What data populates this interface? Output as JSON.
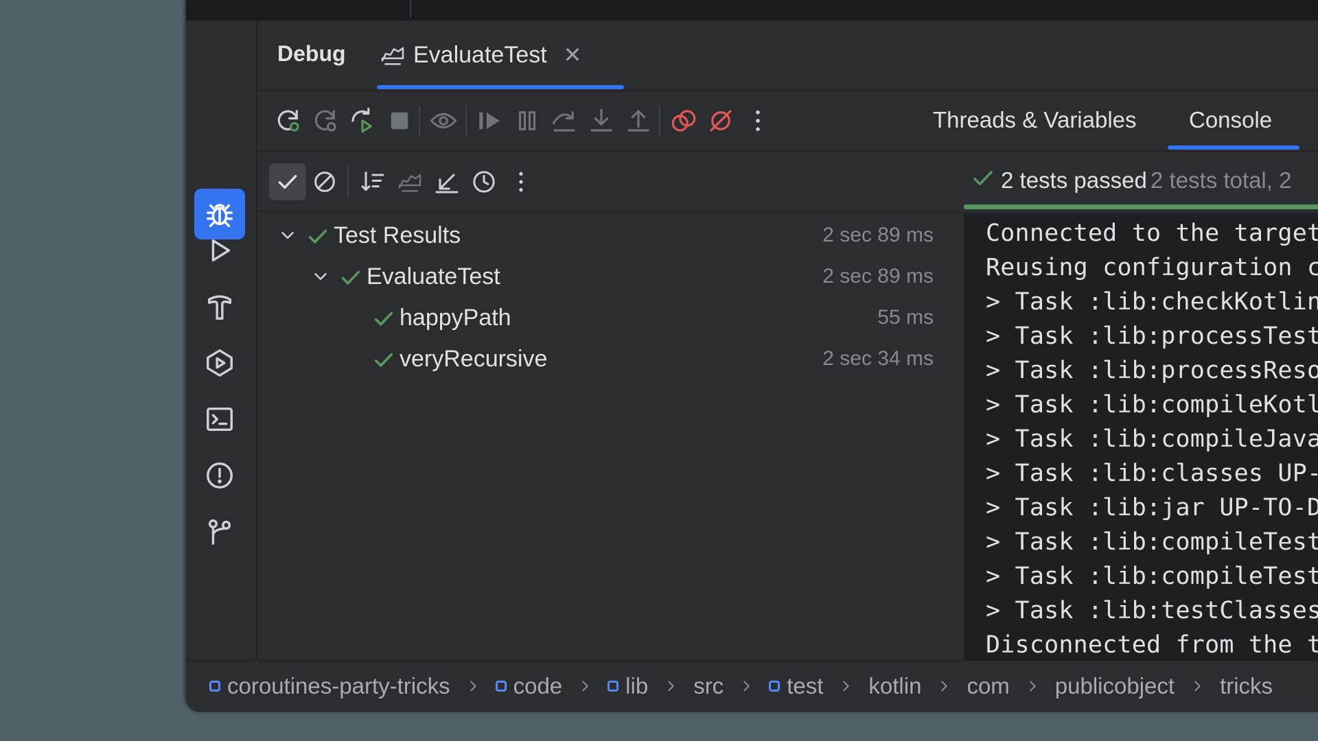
{
  "tabs": {
    "debug_label": "Debug",
    "eval_label": "EvaluateTest",
    "close_glyph": "✕"
  },
  "right_tabs": {
    "threads_label": "Threads & Variables",
    "console_label": "Console"
  },
  "status": {
    "passed": "2 tests passed",
    "total": "2 tests total, 2"
  },
  "tree": [
    {
      "label": "Test Results",
      "duration": "2 sec 89 ms"
    },
    {
      "label": "EvaluateTest",
      "duration": "2 sec 89 ms"
    },
    {
      "label": "happyPath",
      "duration": "55 ms"
    },
    {
      "label": "veryRecursive",
      "duration": "2 sec 34 ms"
    }
  ],
  "console_lines": [
    "Connected to the target VI",
    "Reusing configuration cach",
    "> Task :lib:checkKotlinGra",
    "> Task :lib:processTestRes",
    "> Task :lib:processResourc",
    "> Task :lib:compileKotlin",
    "> Task :lib:compileJava NO",
    "> Task :lib:classes UP-TO-",
    "> Task :lib:jar UP-TO-DATE",
    "> Task :lib:compileTestKot",
    "> Task :lib:compileTestJav",
    "> Task :lib:testClasses UI",
    "Disconnected from the targ"
  ],
  "breadcrumb": [
    "coroutines-party-tricks",
    "code",
    "lib",
    "src",
    "test",
    "kotlin",
    "com",
    "publicobject",
    "tricks"
  ],
  "colors": {
    "accent": "#3574f0",
    "pass_green": "#57965c",
    "stop_red": "#e55757"
  },
  "icons": {
    "strip": [
      "debug-icon",
      "run-icon",
      "build-icon",
      "services-icon",
      "terminal-icon",
      "problems-icon",
      "git-icon"
    ]
  }
}
